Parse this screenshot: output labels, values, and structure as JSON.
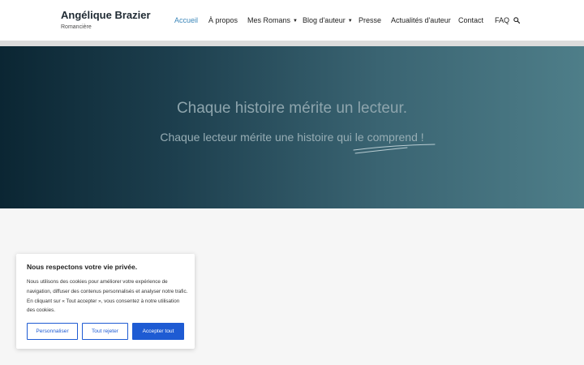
{
  "site": {
    "title": "Angélique Brazier",
    "subtitle": "Romancière"
  },
  "nav": {
    "items": [
      {
        "label": "Accueil",
        "active": true,
        "dropdown": false
      },
      {
        "label": "À propos",
        "active": false,
        "dropdown": false
      },
      {
        "label": "Mes Romans",
        "active": false,
        "dropdown": true
      },
      {
        "label": "Blog d'auteur",
        "active": false,
        "dropdown": true
      },
      {
        "label": "Presse",
        "active": false,
        "dropdown": false
      },
      {
        "label": "Actualités d'auteur",
        "active": false,
        "dropdown": false
      },
      {
        "label": "Contact",
        "active": false,
        "dropdown": false
      },
      {
        "label": "FAQ",
        "active": false,
        "dropdown": false
      }
    ],
    "search_icon": "search-icon",
    "dropdown_icon": "chevron-down-icon"
  },
  "hero": {
    "title": "Chaque histoire mérite un lecteur.",
    "subtitle": "Chaque lecteur mérite une histoire qui le comprend !"
  },
  "cookie": {
    "title": "Nous respectons votre vie privée.",
    "text": "Nous utilisons des cookies pour améliorer votre expérience de navigation, diffuser des contenus personnalisés et analyser notre trafic. En cliquant sur « Tout accepter », vous consentez à notre utilisation des cookies.",
    "customize_label": "Personnaliser",
    "reject_label": "Tout rejeter",
    "accept_label": "Accepter tout"
  },
  "colors": {
    "accent": "#3a86b9",
    "button": "#1e5bd3"
  }
}
